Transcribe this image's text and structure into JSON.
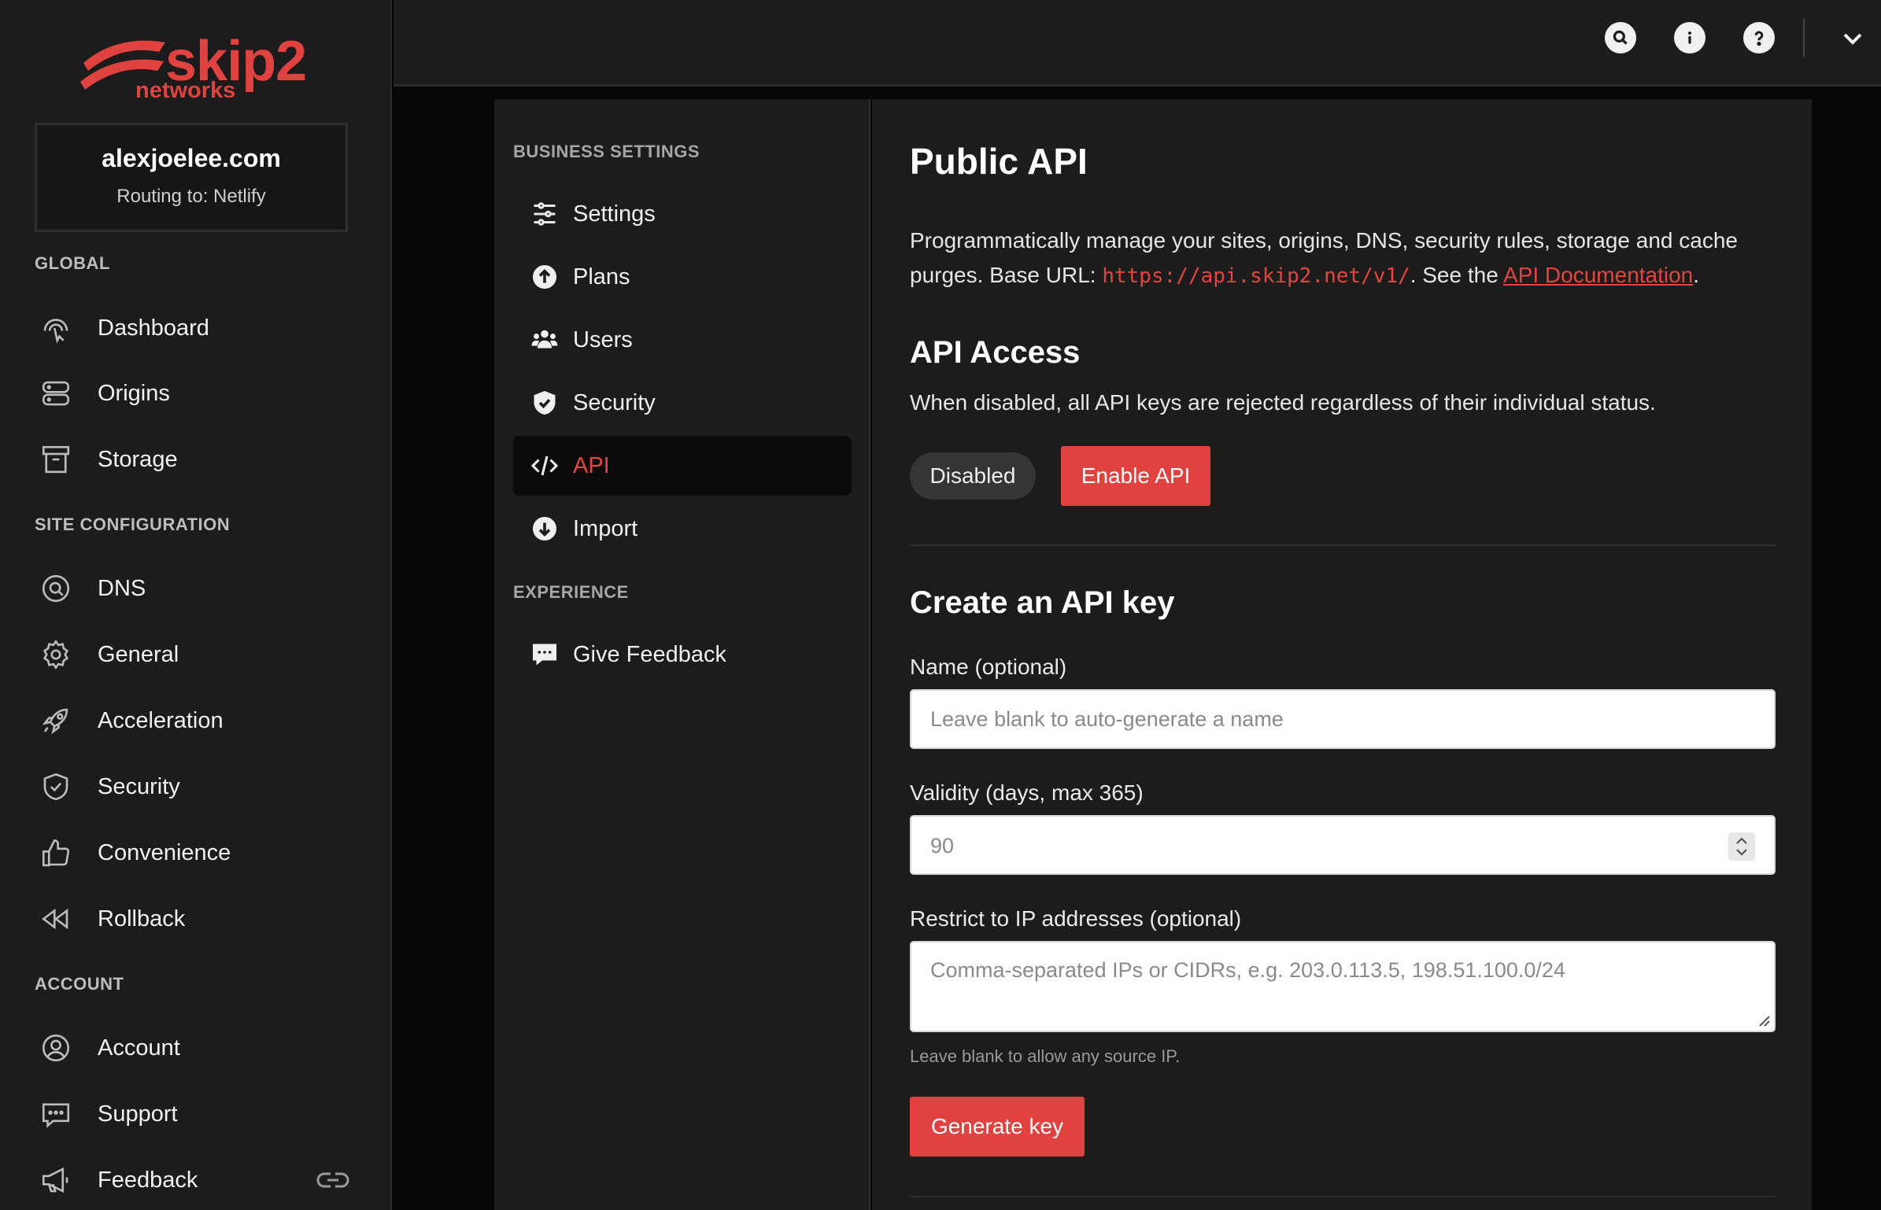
{
  "brand": {
    "logo_word": "skip2",
    "logo_sub": "networks",
    "accent_color": "#e0423f"
  },
  "site": {
    "name": "alexjoelee.com",
    "routing": "Routing to: Netlify"
  },
  "sidebar": {
    "sections": {
      "global": "GLOBAL",
      "site_config": "SITE CONFIGURATION",
      "account": "ACCOUNT"
    },
    "items": {
      "dashboard": {
        "label": "Dashboard",
        "icon": "dashboard-icon"
      },
      "origins": {
        "label": "Origins",
        "icon": "server-icon"
      },
      "storage": {
        "label": "Storage",
        "icon": "archive-icon"
      },
      "dns": {
        "label": "DNS",
        "icon": "dns-search-icon"
      },
      "general": {
        "label": "General",
        "icon": "gear-icon"
      },
      "acceleration": {
        "label": "Acceleration",
        "icon": "rocket-icon"
      },
      "security": {
        "label": "Security",
        "icon": "shield-check-icon"
      },
      "convenience": {
        "label": "Convenience",
        "icon": "thumbs-up-icon"
      },
      "rollback": {
        "label": "Rollback",
        "icon": "rewind-icon"
      },
      "account": {
        "label": "Account",
        "icon": "user-circle-icon"
      },
      "support": {
        "label": "Support",
        "icon": "chat-icon"
      },
      "feedback": {
        "label": "Feedback",
        "icon": "megaphone-icon"
      }
    }
  },
  "topbar": {
    "icons": [
      "search-icon",
      "info-icon",
      "help-icon",
      "chevron-down-icon"
    ]
  },
  "settings_nav": {
    "sections": {
      "business": "BUSINESS SETTINGS",
      "experience": "EXPERIENCE"
    },
    "items": {
      "settings": "Settings",
      "plans": "Plans",
      "users": "Users",
      "security": "Security",
      "api": "API",
      "import": "Import",
      "feedback": "Give Feedback"
    },
    "active": "API"
  },
  "main": {
    "title": "Public API",
    "desc_prefix": "Programmatically manage your sites, origins, DNS, security rules, storage and cache purges. Base URL: ",
    "base_url": "https://api.skip2.net/v1/",
    "desc_mid": ". See the ",
    "doc_link": "API Documentation",
    "desc_suffix": ".",
    "access": {
      "title": "API Access",
      "subtitle": "When disabled, all API keys are rejected regardless of their individual status.",
      "status": "Disabled",
      "enable_button": "Enable API"
    },
    "create": {
      "title": "Create an API key",
      "name_label": "Name (optional)",
      "name_placeholder": "Leave blank to auto-generate a name",
      "validity_label": "Validity (days, max 365)",
      "validity_value": "90",
      "ip_label": "Restrict to IP addresses (optional)",
      "ip_placeholder": "Comma-separated IPs or CIDRs, e.g. 203.0.113.5, 198.51.100.0/24",
      "ip_help": "Leave blank to allow any source IP.",
      "generate_button": "Generate key"
    }
  }
}
